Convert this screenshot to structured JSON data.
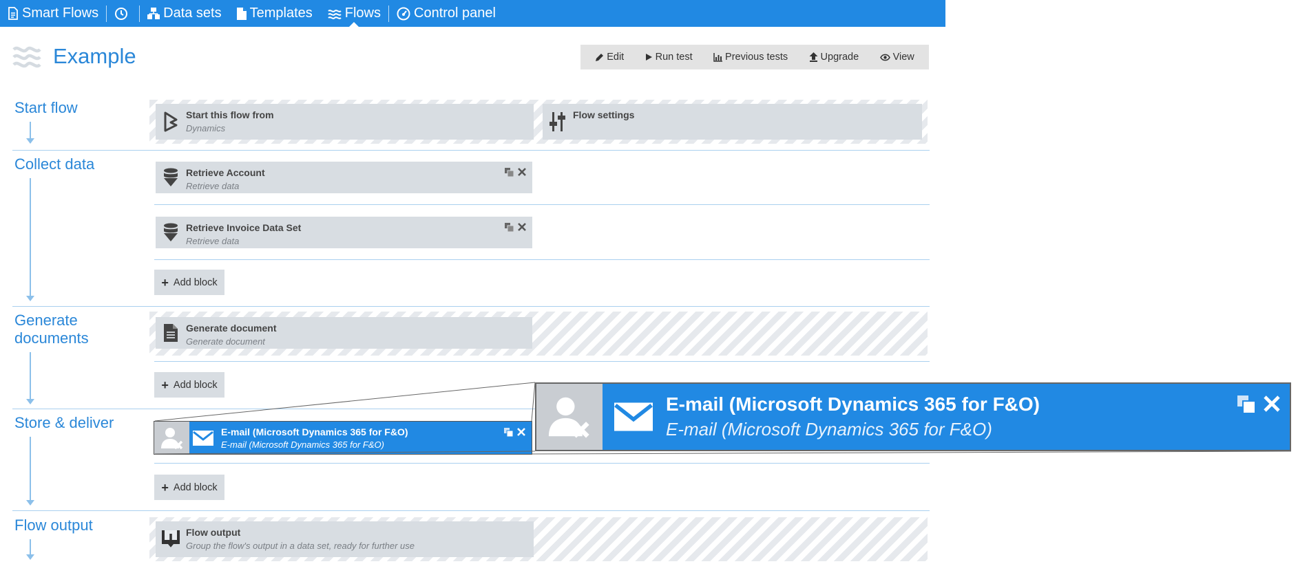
{
  "nav": {
    "app_title": "Smart Flows",
    "data_sets": "Data sets",
    "templates": "Templates",
    "flows": "Flows",
    "control_panel": "Control panel"
  },
  "page": {
    "title": "Example"
  },
  "toolbar": {
    "edit": "Edit",
    "run_test": "Run test",
    "previous_tests": "Previous tests",
    "upgrade": "Upgrade",
    "view": "View"
  },
  "stages": {
    "start_flow": "Start flow",
    "collect_data": "Collect data",
    "generate_documents": "Generate documents",
    "store_deliver": "Store & deliver",
    "flow_output": "Flow output"
  },
  "blocks": {
    "start_from": {
      "title": "Start this flow from",
      "subtitle": "Dynamics"
    },
    "flow_settings": {
      "title": "Flow settings"
    },
    "retrieve_account": {
      "title": "Retrieve Account",
      "subtitle": "Retrieve data"
    },
    "retrieve_invoice": {
      "title": "Retrieve Invoice Data Set",
      "subtitle": "Retrieve data"
    },
    "generate_document": {
      "title": "Generate document",
      "subtitle": "Generate document"
    },
    "email": {
      "title": "E-mail (Microsoft Dynamics 365 for F&O)",
      "subtitle": "E-mail (Microsoft Dynamics 365 for F&O)"
    },
    "flow_output": {
      "title": "Flow output",
      "subtitle": "Group the flow's output in a data set, ready for further use"
    }
  },
  "add_block": "Add block",
  "colors": {
    "brand_blue": "#2189e3",
    "block_gray": "#d8dde2",
    "label_blue": "#2a87d8"
  }
}
